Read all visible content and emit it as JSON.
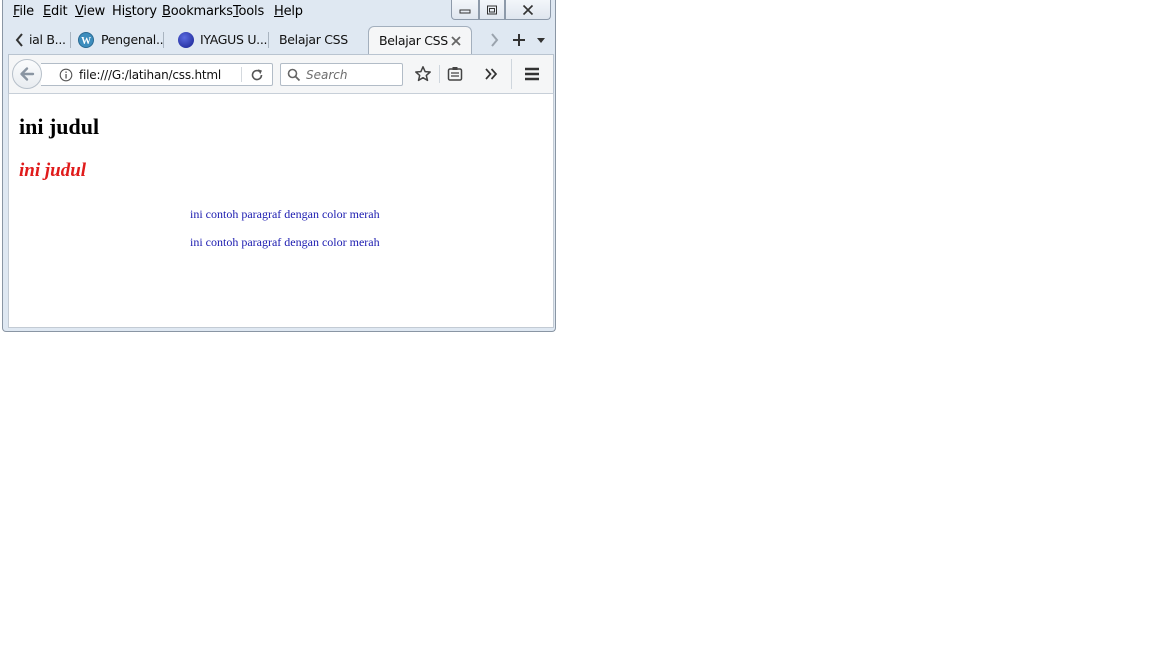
{
  "menu": [
    {
      "pre": "",
      "u": "F",
      "post": "ile"
    },
    {
      "pre": "",
      "u": "E",
      "post": "dit"
    },
    {
      "pre": "",
      "u": "V",
      "post": "iew"
    },
    {
      "pre": "Hi",
      "u": "s",
      "post": "tory"
    },
    {
      "pre": "",
      "u": "B",
      "post": "ookmarks"
    },
    {
      "pre": "",
      "u": "T",
      "post": "ools"
    },
    {
      "pre": "",
      "u": "H",
      "post": "elp"
    }
  ],
  "tabs": [
    {
      "label": "ial B..."
    },
    {
      "label": "Pengenal..."
    },
    {
      "label": "IYAGUS U..."
    },
    {
      "label": "Belajar CSS"
    },
    {
      "label": "Belajar CSS"
    }
  ],
  "nav": {
    "url": "file:///G:/latihan/css.html",
    "search_placeholder": "Search"
  },
  "page": {
    "heading1": "ini judul",
    "heading2": "ini judul",
    "paragraphs": [
      "ini contoh paragraf dengan color merah",
      "ini contoh paragraf dengan color merah"
    ]
  },
  "colors": {
    "heading2": "#e01b1b",
    "paragraph": "#1b1bb0"
  },
  "icons": [
    "back-arrow-icon",
    "info-icon",
    "reload-icon",
    "search-icon",
    "bookmark-star-icon",
    "reader-icon",
    "overflow-icon",
    "hamburger-menu-icon",
    "close-tab-icon",
    "new-tab-icon",
    "tab-list-icon",
    "scroll-left-icon",
    "scroll-right-icon"
  ]
}
